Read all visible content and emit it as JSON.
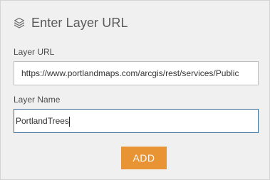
{
  "header": {
    "icon": "layers-icon",
    "title": "Enter Layer URL"
  },
  "form": {
    "url_label": "Layer URL",
    "url_value": "https://www.portlandmaps.com/arcgis/rest/services/Public",
    "name_label": "Layer Name",
    "name_value": "PortlandTrees",
    "add_label": "ADD"
  },
  "colors": {
    "panel_bg": "#f0f0f0",
    "add_button": "#e89334",
    "focus_border": "#3f6e9e"
  }
}
